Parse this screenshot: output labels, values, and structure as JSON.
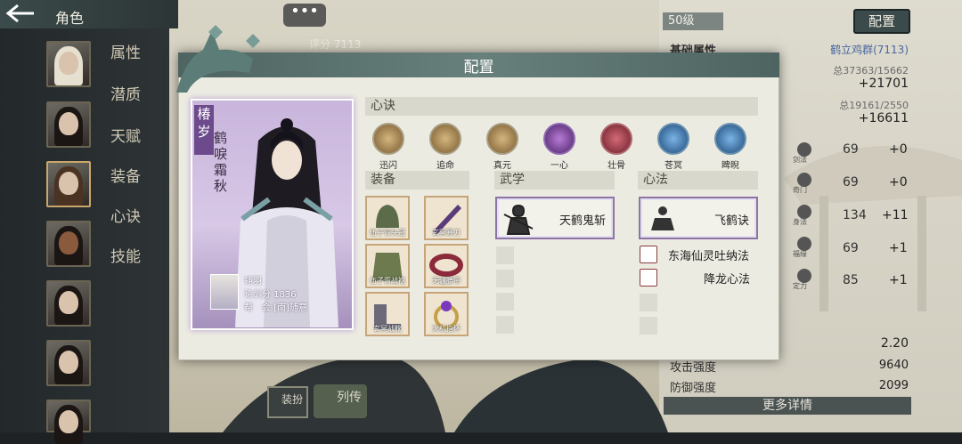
{
  "header": {
    "back_icon": "back-arrow-icon",
    "title": "角色",
    "chat_icon": "chat-bubble-icon",
    "score_top": "评分 7113"
  },
  "nav": {
    "items": [
      {
        "label": "属性"
      },
      {
        "label": "潜质"
      },
      {
        "label": "天赋"
      },
      {
        "label": "装备"
      },
      {
        "label": "心诀"
      },
      {
        "label": "技能"
      }
    ]
  },
  "right_panel": {
    "level": "50级",
    "config_button": "配置",
    "basic_attr_label": "基础属性",
    "player_name": "鹤立鸡群(7113)",
    "stat_a_line": "总37363/15662",
    "stat_a_bonus": "+21701",
    "stat_b_line": "总19161/2550",
    "stat_b_bonus": "+16611",
    "attr_rows": [
      {
        "name": "剑法",
        "value": "69",
        "bonus": "+0"
      },
      {
        "name": "奇门",
        "value": "69",
        "bonus": "+0"
      },
      {
        "name": "身法",
        "value": "134",
        "bonus": "+11"
      },
      {
        "name": "福缘",
        "value": "69",
        "bonus": "+1"
      },
      {
        "name": "定力",
        "value": "85",
        "bonus": "+1"
      }
    ],
    "crit_value": "2.20",
    "attack_label": "攻击强度",
    "attack_value": "9640",
    "defense_label": "防御强度",
    "defense_value": "2099",
    "more_details": "更多详情"
  },
  "bottom_left": {
    "outfit_label": "装扮",
    "bio_label": "列传"
  },
  "dialog": {
    "title": "配置",
    "card": {
      "tag": "椿岁",
      "name": "鹤唳霜秋",
      "player": "翎羽",
      "score": "论剑分 1836",
      "guild": "帮　会 [南]随意"
    },
    "xinjue_header": "心诀",
    "skills": [
      {
        "label": "迅闪"
      },
      {
        "label": "追命"
      },
      {
        "label": "真元"
      },
      {
        "label": "一心"
      },
      {
        "label": "壮骨"
      },
      {
        "label": "苍冥"
      },
      {
        "label": "睥睨"
      }
    ],
    "equip_header": "装备",
    "equipment": [
      {
        "label": "伍子胥头冠"
      },
      {
        "label": "玄冥寒刃"
      },
      {
        "label": "伍子胥战袍"
      },
      {
        "label": "无疆腰带"
      },
      {
        "label": "玄冥战靴"
      },
      {
        "label": "天机指环"
      }
    ],
    "wuxue_header": "武学",
    "wuxue_main": "天鹤鬼斩",
    "xinfa_header": "心法",
    "xinfa_main": "飞鹤诀",
    "xinfa_list": [
      {
        "label": "东海仙灵吐纳法"
      },
      {
        "label": "降龙心法"
      }
    ]
  }
}
